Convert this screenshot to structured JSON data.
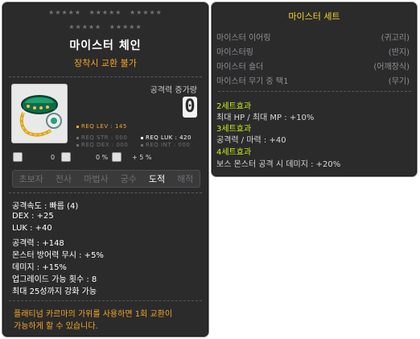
{
  "item": {
    "stars_row_1": [
      "★★★★★",
      "★★★★★",
      "★★★★★"
    ],
    "stars_row_2": [
      "★★★★★",
      "★★★★★"
    ],
    "name": "마이스터 체인",
    "trade_note": "장착시 교환 불가",
    "attack_increase_label": "공격력 증가량",
    "attack_increase_value": "0",
    "req": {
      "lev": "REQ LEV : 145",
      "str": "REQ STR : 000",
      "luk": "REQ LUK : 420",
      "dex": "REQ DEX : 000",
      "int": "REQ INT : 000"
    },
    "stat_icons": [
      {
        "icon": "monster-icon",
        "value": "0"
      },
      {
        "icon": "defense-icon",
        "value": "0 %"
      },
      {
        "icon": "attack-icon",
        "value": "+ 5 %"
      }
    ],
    "jobs": [
      "초보자",
      "전사",
      "마법사",
      "궁수",
      "도적",
      "해적"
    ],
    "active_job": "도적",
    "stats": [
      "공격속도 : 빠름 (4)",
      "DEX : +25",
      "LUK : +40",
      "공격력 : +148",
      "몬스터 방어력 무시 : +5%",
      "데미지 : +15%",
      "업그레이드 가능 횟수 : 8",
      "최대 25성까지 강화 가능"
    ],
    "exchange_note_line1": "플래티넘 카르마의 가위를 사용하면 1회 교환이",
    "exchange_note_line2": "가능하게 할 수 있습니다."
  },
  "set": {
    "title": "마이스터 세트",
    "items": [
      {
        "name": "마이스터 이어링",
        "type": "(귀고리)"
      },
      {
        "name": "마이스터링",
        "type": "(반지)"
      },
      {
        "name": "마이스터 숄더",
        "type": "(어깨장식)"
      },
      {
        "name": "마이스터 무기 중 택1",
        "type": "(무기)"
      }
    ],
    "effects": [
      {
        "head": "2세트효과",
        "lines": [
          "최대 HP / 최대 MP : +10%"
        ]
      },
      {
        "head": "3세트효과",
        "lines": [
          "공격력 / 마력 : +40"
        ]
      },
      {
        "head": "4세트효과",
        "lines": [
          "보스 몬스터 공격 시 데미지 : +20%"
        ]
      }
    ]
  },
  "colors": {
    "panel_bg": "#2b2b2c",
    "accent_orange": "#f5a623",
    "set_title": "#f5d423",
    "set_effect_head": "#ccee11"
  }
}
